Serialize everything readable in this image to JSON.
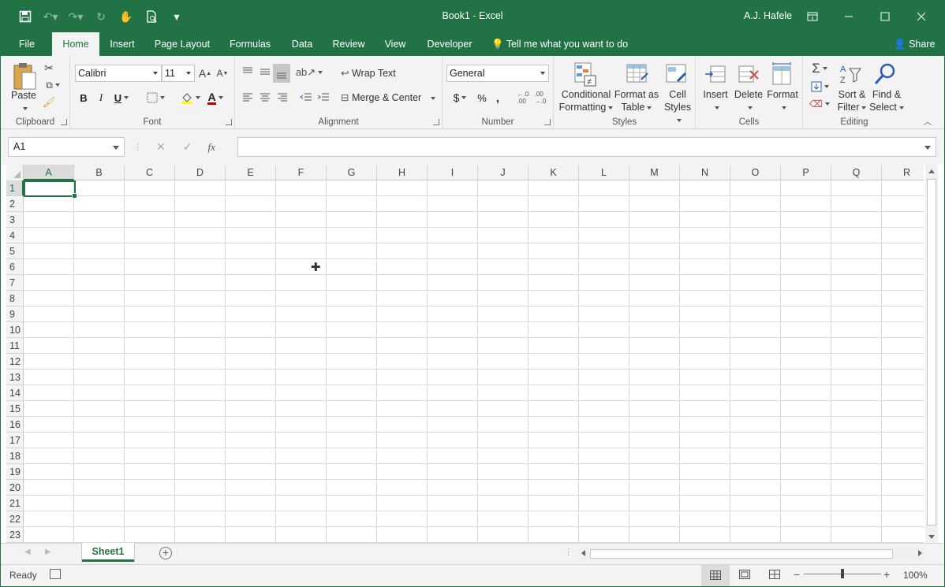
{
  "titlebar": {
    "doc_title": "Book1  -  Excel",
    "user": "A.J. Hafele",
    "qat_icons": [
      "save-icon",
      "undo-icon",
      "redo-icon",
      "repeat-icon",
      "touch-mode-icon",
      "print-preview-icon",
      "customize-qat-icon"
    ]
  },
  "tabs": [
    "File",
    "Home",
    "Insert",
    "Page Layout",
    "Formulas",
    "Data",
    "Review",
    "View",
    "Developer"
  ],
  "active_tab": "Home",
  "tell_me": "Tell me what you want to do",
  "share": "Share",
  "ribbon": {
    "clipboard": {
      "label": "Clipboard",
      "paste": "Paste"
    },
    "font": {
      "label": "Font",
      "font_name": "Calibri",
      "font_size": "11",
      "bold": "B",
      "italic": "I",
      "underline": "U",
      "font_color_letter": "A"
    },
    "alignment": {
      "label": "Alignment",
      "wrap_text": "Wrap Text",
      "merge_center": "Merge & Center"
    },
    "number": {
      "label": "Number",
      "format": "General",
      "currency": "$",
      "percent": "%",
      "comma": ","
    },
    "styles": {
      "label": "Styles",
      "conditional_l1": "Conditional",
      "conditional_l2": "Formatting",
      "format_table_l1": "Format as",
      "format_table_l2": "Table",
      "cell_styles_l1": "Cell",
      "cell_styles_l2": "Styles"
    },
    "cells": {
      "label": "Cells",
      "insert": "Insert",
      "delete": "Delete",
      "format": "Format"
    },
    "editing": {
      "label": "Editing",
      "sort_l1": "Sort &",
      "sort_l2": "Filter",
      "find_l1": "Find &",
      "find_l2": "Select"
    }
  },
  "formula_bar": {
    "name_box": "A1",
    "fx": "fx",
    "formula": ""
  },
  "columns": [
    "A",
    "B",
    "C",
    "D",
    "E",
    "F",
    "G",
    "H",
    "I",
    "J",
    "K",
    "L",
    "M",
    "N",
    "O",
    "P",
    "Q",
    "R"
  ],
  "rows": [
    "1",
    "2",
    "3",
    "4",
    "5",
    "6",
    "7",
    "8",
    "9",
    "10",
    "11",
    "12",
    "13",
    "14",
    "15",
    "16",
    "17",
    "18",
    "19",
    "20",
    "21",
    "22",
    "23"
  ],
  "active_cell": "A1",
  "sheets": [
    "Sheet1"
  ],
  "status": {
    "ready": "Ready",
    "zoom": "100%"
  },
  "colors": {
    "accent": "#217346",
    "ribbon_bg": "#f3f3f3"
  }
}
